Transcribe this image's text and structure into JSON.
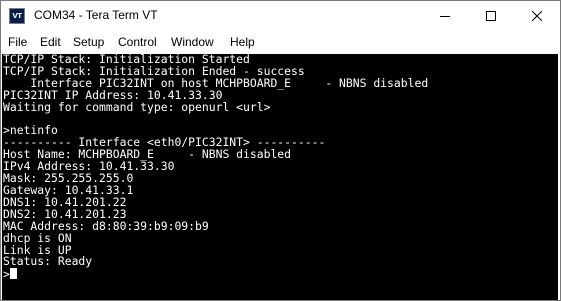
{
  "window": {
    "title": "COM34 - Tera Term VT",
    "icon_name": "tera-term-icon",
    "icon_text": "VT"
  },
  "menu": [
    "File",
    "Edit",
    "Setup",
    "Control",
    "Window",
    "Help"
  ],
  "terminal": {
    "lines": [
      "TCP/IP Stack: Initialization Started",
      "TCP/IP Stack: Initialization Ended - success",
      "    Interface PIC32INT on host MCHPBOARD_E     - NBNS disabled",
      "PIC32INT IP Address: 10.41.33.30",
      "Waiting for command type: openurl <url>",
      "",
      ">netinfo",
      "---------- Interface <eth0/PIC32INT> ----------",
      "Host Name: MCHPBOARD_E     - NBNS disabled",
      "IPv4 Address: 10.41.33.30",
      "Mask: 255.255.255.0",
      "Gateway: 10.41.33.1",
      "DNS1: 10.41.201.22",
      "DNS2: 10.41.201.23",
      "MAC Address: d8:80:39:b9:09:b9",
      "dhcp is ON",
      "Link is UP",
      "Status: Ready"
    ],
    "prompt": ">",
    "background_color": "#000000",
    "text_color": "#ffffff"
  }
}
